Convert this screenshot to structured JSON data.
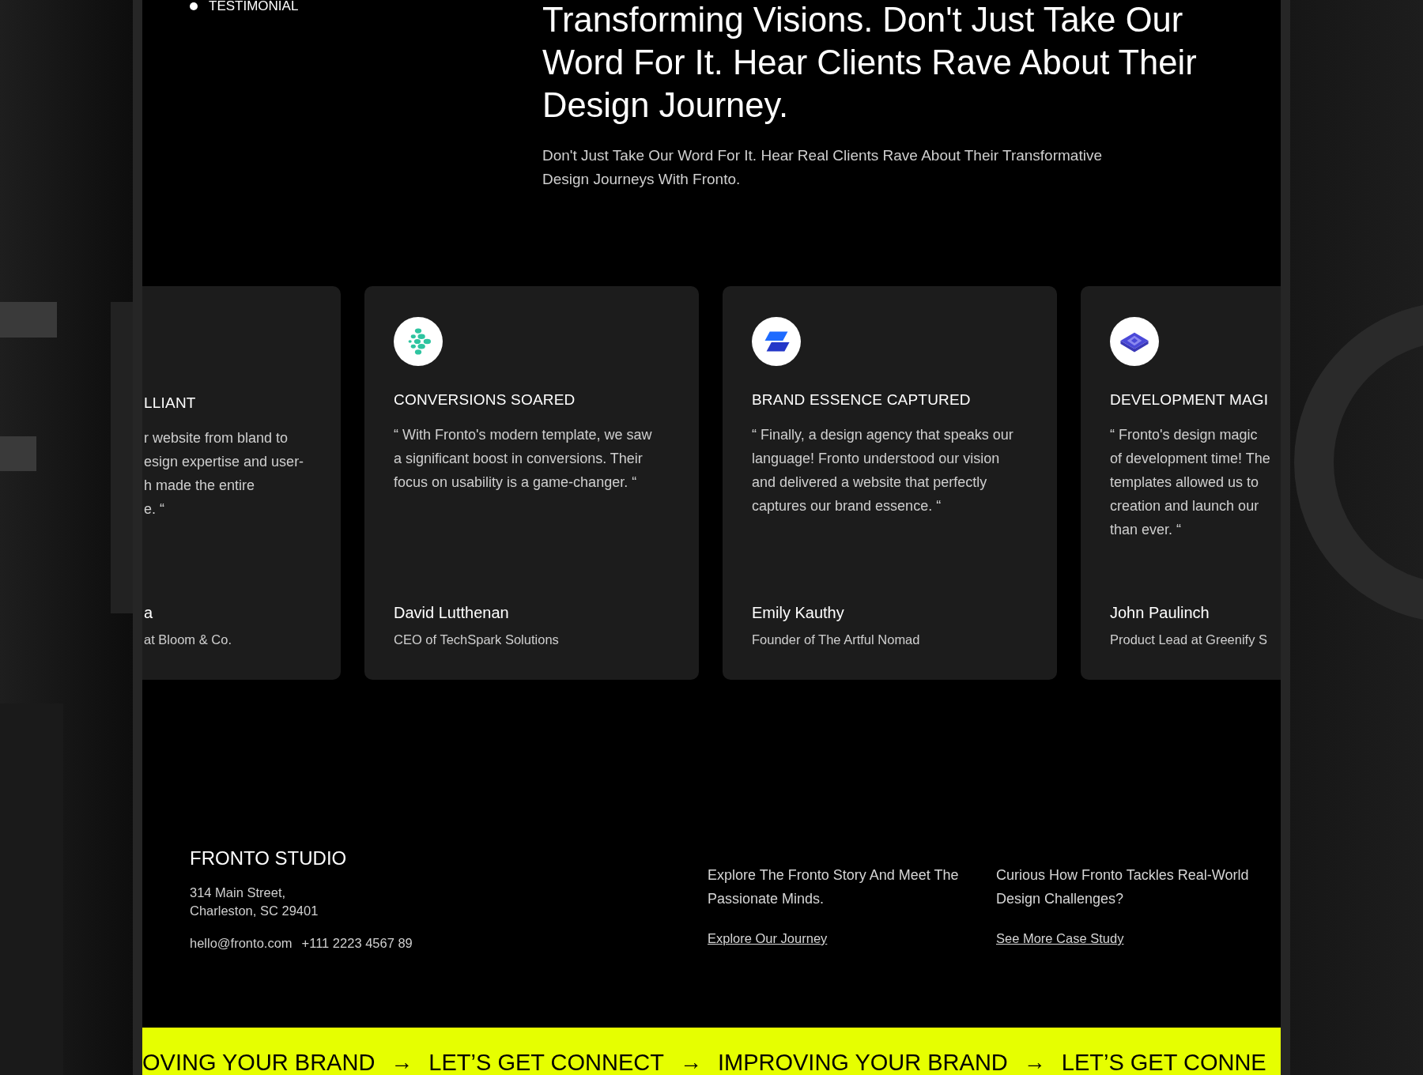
{
  "section_label": "TESTIMONIAL",
  "heading": "Transforming Visions. Don't Just Take Our Word For It. Hear Clients Rave About Their Design Journey.",
  "subtitle": "Don't Just Take Our Word For It. Hear Real Clients Rave About Their Transformative Design Journeys With Fronto.",
  "testimonials": [
    {
      "kind": "clipped_left",
      "title": "LLIANT",
      "quote_lines": [
        "r website from bland to",
        "esign expertise and user-",
        "h made the entire",
        "e. “"
      ],
      "name": "a",
      "role": "at Bloom & Co."
    },
    {
      "kind": "full",
      "logo": {
        "kind": "dots"
      },
      "title": "CONVERSIONS SOARED",
      "quote": "“ With Fronto's modern template, we saw a significant boost in conversions. Their focus on usability is a game-changer. “",
      "name": "David Lutthenan",
      "role": "CEO of TechSpark Solutions"
    },
    {
      "kind": "full",
      "logo": {
        "kind": "slants"
      },
      "title": "BRAND ESSENCE CAPTURED",
      "quote": "“ Finally, a design agency that speaks our language! Fronto understood our vision and delivered a website that perfectly captures our brand essence. “",
      "name": "Emily Kauthy",
      "role": "Founder of The Artful Nomad"
    },
    {
      "kind": "clipped_right",
      "logo": {
        "kind": "layers"
      },
      "title": "DEVELOPMENT MAGI",
      "quote_lines": [
        "“ Fronto's design magic",
        "of development time! The",
        "templates allowed us to",
        "creation and launch our",
        "than ever. “"
      ],
      "name": "John Paulinch",
      "role": "Product Lead at Greenify S"
    }
  ],
  "footer": {
    "brand": "FRONTO STUDIO",
    "address_lines": [
      "314 Main Street,",
      "Charleston, SC 29401"
    ],
    "email": "hello@fronto.com",
    "phone": "+111 2223 4567 89",
    "columns": [
      {
        "text": "Explore The Fronto Story And Meet The Passionate Minds.",
        "link": "Explore Our Journey"
      },
      {
        "text": "Curious How Fronto Tackles Real-World Design Challenges?",
        "link": "See More Case Study"
      }
    ]
  },
  "marquee": [
    {
      "kind": "text",
      "text": "OVING YOUR BRAND"
    },
    {
      "kind": "arrow",
      "text": "→"
    },
    {
      "kind": "text",
      "text": "LET’S GET CONNECT"
    },
    {
      "kind": "arrow",
      "text": "→"
    },
    {
      "kind": "text",
      "text": "IMPROVING YOUR BRAND"
    },
    {
      "kind": "arrow",
      "text": "→"
    },
    {
      "kind": "text",
      "text": "LET’S GET CONNE"
    }
  ]
}
